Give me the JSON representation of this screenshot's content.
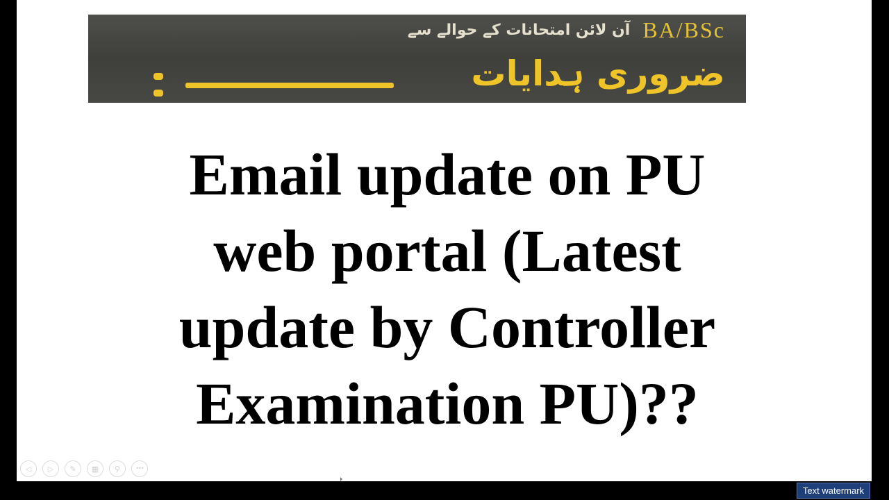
{
  "banner": {
    "top_label": "BA/BSc",
    "top_urdu": "آن لائن امتحانات کے حوالے سے",
    "bottom_urdu": "ضروری ہدایات",
    "colors": {
      "background": "#474844",
      "accent": "#efc428"
    }
  },
  "headline": {
    "lines": [
      "Email update on PU",
      "web portal (Latest",
      "update by Controller",
      "Examination PU)??"
    ]
  },
  "controls": {
    "buttons": [
      {
        "name": "previous-slide",
        "icon": "chevron-left-icon",
        "glyph": "◁"
      },
      {
        "name": "next-slide",
        "icon": "chevron-right-icon",
        "glyph": "▷"
      },
      {
        "name": "pen",
        "icon": "pen-icon",
        "glyph": "✎"
      },
      {
        "name": "slides-view",
        "icon": "grid-icon",
        "glyph": "▦"
      },
      {
        "name": "zoom",
        "icon": "magnifier-icon",
        "glyph": "⚲"
      },
      {
        "name": "more-options",
        "icon": "ellipsis-icon",
        "glyph": "•••"
      }
    ]
  },
  "watermark": {
    "label": "Text watermark",
    "background": "#1e3f7a"
  }
}
